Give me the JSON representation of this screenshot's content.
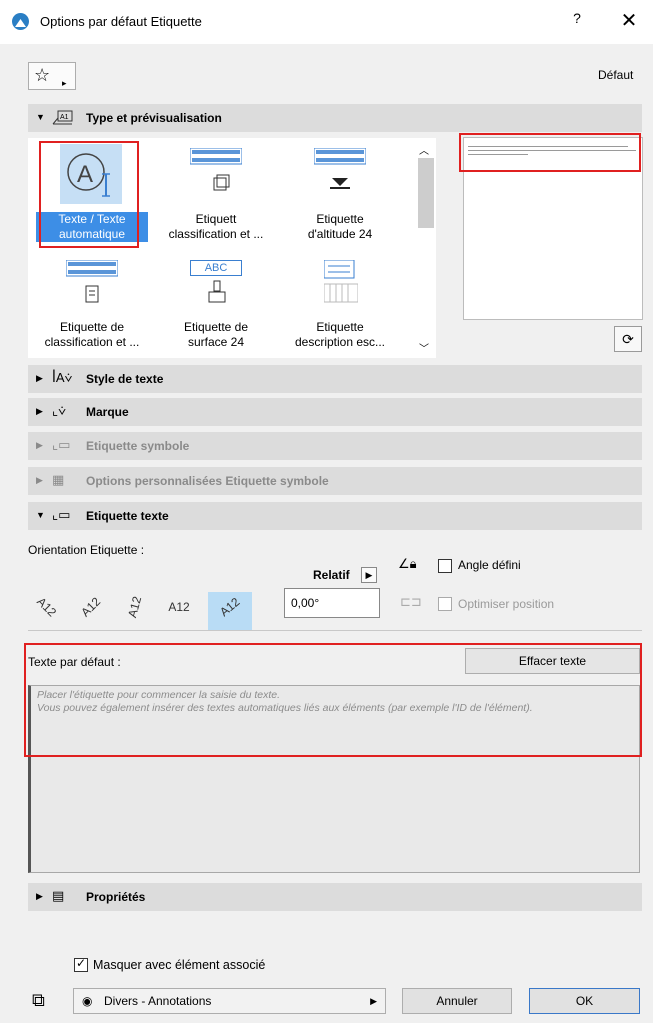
{
  "window": {
    "title": "Options par défaut Etiquette",
    "help": "?",
    "close": "✕"
  },
  "favorites": {
    "star": "☆",
    "arrow": "▸",
    "preset": "Défaut"
  },
  "sections": {
    "type": {
      "label": "Type et prévisualisation",
      "icon": "A1"
    },
    "style": {
      "label": "Style de texte"
    },
    "marque": {
      "label": "Marque"
    },
    "symbole": {
      "label": "Etiquette symbole"
    },
    "perso": {
      "label": "Options personnalisées Etiquette symbole"
    },
    "texte": {
      "label": "Etiquette texte"
    },
    "props": {
      "label": "Propriétés"
    }
  },
  "gallery": {
    "items": [
      {
        "line1": "Texte / Texte",
        "line2": "automatique"
      },
      {
        "line1": "Etiquett",
        "line2": "classification et ..."
      },
      {
        "line1": "Etiquette",
        "line2": "d'altitude 24"
      },
      {
        "line1": "Etiquette de",
        "line2": "classification et ..."
      },
      {
        "line1": "Etiquette de",
        "line2": "surface 24"
      },
      {
        "line1": "Etiquette",
        "line2": "description esc..."
      }
    ],
    "abc": "ABC"
  },
  "orientation": {
    "label": "Orientation Etiquette :",
    "relatif": "Relatif",
    "angle_value": "0,00°",
    "angle_defini": "Angle défini",
    "optimiser": "Optimiser position",
    "icon_text": "A12"
  },
  "texte_defaut": {
    "label": "Texte par défaut :",
    "effacer": "Effacer texte",
    "placeholder1": "Placer l'étiquette pour commencer la saisie du texte.",
    "placeholder2": "Vous pouvez également insérer des textes automatiques liés aux éléments (par exemple l'ID de l'élément)."
  },
  "footer": {
    "masquer": "Masquer avec élément associé",
    "layer": "Divers - Annotations",
    "annuler": "Annuler",
    "ok": "OK"
  }
}
